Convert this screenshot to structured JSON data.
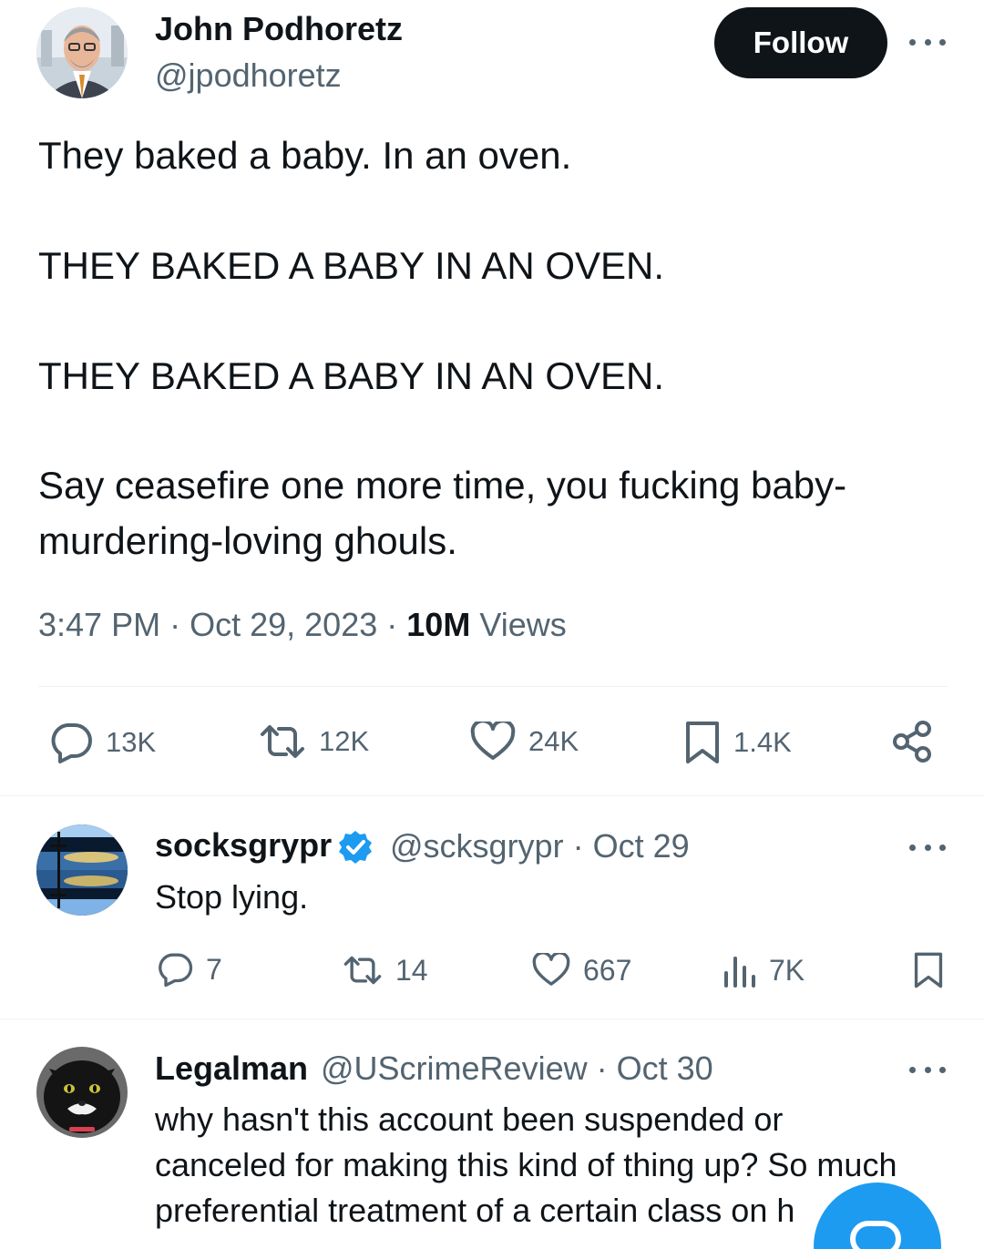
{
  "tweet": {
    "author_name": "John Podhoretz",
    "author_handle": "@jpodhoretz",
    "follow_label": "Follow",
    "lines": [
      "They baked a baby. In an oven.",
      "THEY BAKED A BABY IN AN OVEN.",
      "THEY BAKED A BABY IN AN OVEN.",
      "Say ceasefire one more time, you fucking baby-",
      "murdering-loving ghouls."
    ],
    "time": "3:47 PM",
    "date": "Oct 29, 2023",
    "views_count": "10M",
    "views_label": "Views",
    "separator": "·",
    "stats": {
      "replies": "13K",
      "reposts": "12K",
      "likes": "24K",
      "bookmarks": "1.4K"
    }
  },
  "replies": [
    {
      "name": "socksgrypr",
      "handle": "@scksgrypr",
      "date": "Oct 29",
      "text": [
        "Stop lying."
      ],
      "verified": true,
      "stats": {
        "replies": "7",
        "reposts": "14",
        "likes": "667",
        "views": "7K"
      }
    },
    {
      "name": "Legalman",
      "handle": "@UScrimeReview",
      "date": "Oct 30",
      "text": [
        "why hasn't this account been suspended or",
        "canceled for making this kind of thing up? So much",
        "preferential treatment of a certain class on h"
      ]
    }
  ],
  "colors": {
    "text": "#0f1419",
    "secondary": "#536471",
    "accent": "#1d9bf0",
    "divider": "#eff3f4"
  },
  "icons": [
    "more-icon",
    "reply-icon",
    "repost-icon",
    "like-icon",
    "bookmark-icon",
    "share-icon",
    "views-icon",
    "verified-badge-icon",
    "compose-icon"
  ]
}
